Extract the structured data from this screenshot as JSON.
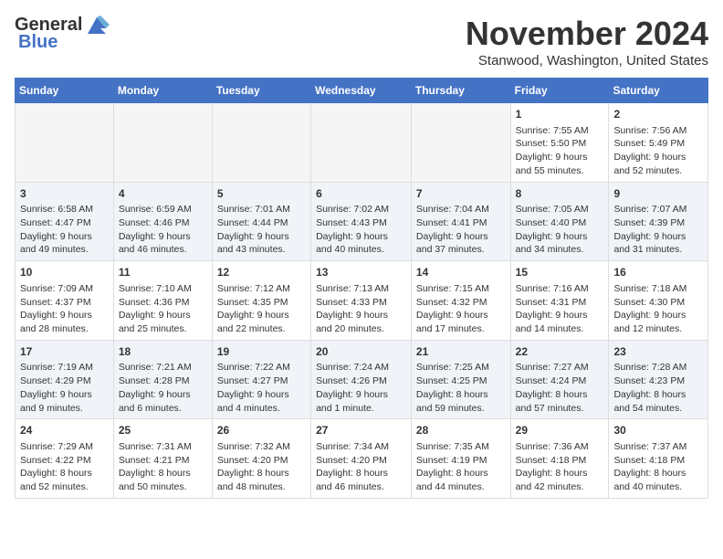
{
  "logo": {
    "general": "General",
    "blue": "Blue"
  },
  "title": "November 2024",
  "location": "Stanwood, Washington, United States",
  "days_of_week": [
    "Sunday",
    "Monday",
    "Tuesday",
    "Wednesday",
    "Thursday",
    "Friday",
    "Saturday"
  ],
  "weeks": [
    [
      {
        "day": "",
        "empty": true
      },
      {
        "day": "",
        "empty": true
      },
      {
        "day": "",
        "empty": true
      },
      {
        "day": "",
        "empty": true
      },
      {
        "day": "",
        "empty": true
      },
      {
        "day": "1",
        "sunrise": "Sunrise: 7:55 AM",
        "sunset": "Sunset: 5:50 PM",
        "daylight": "Daylight: 9 hours and 55 minutes."
      },
      {
        "day": "2",
        "sunrise": "Sunrise: 7:56 AM",
        "sunset": "Sunset: 5:49 PM",
        "daylight": "Daylight: 9 hours and 52 minutes."
      }
    ],
    [
      {
        "day": "3",
        "sunrise": "Sunrise: 6:58 AM",
        "sunset": "Sunset: 4:47 PM",
        "daylight": "Daylight: 9 hours and 49 minutes."
      },
      {
        "day": "4",
        "sunrise": "Sunrise: 6:59 AM",
        "sunset": "Sunset: 4:46 PM",
        "daylight": "Daylight: 9 hours and 46 minutes."
      },
      {
        "day": "5",
        "sunrise": "Sunrise: 7:01 AM",
        "sunset": "Sunset: 4:44 PM",
        "daylight": "Daylight: 9 hours and 43 minutes."
      },
      {
        "day": "6",
        "sunrise": "Sunrise: 7:02 AM",
        "sunset": "Sunset: 4:43 PM",
        "daylight": "Daylight: 9 hours and 40 minutes."
      },
      {
        "day": "7",
        "sunrise": "Sunrise: 7:04 AM",
        "sunset": "Sunset: 4:41 PM",
        "daylight": "Daylight: 9 hours and 37 minutes."
      },
      {
        "day": "8",
        "sunrise": "Sunrise: 7:05 AM",
        "sunset": "Sunset: 4:40 PM",
        "daylight": "Daylight: 9 hours and 34 minutes."
      },
      {
        "day": "9",
        "sunrise": "Sunrise: 7:07 AM",
        "sunset": "Sunset: 4:39 PM",
        "daylight": "Daylight: 9 hours and 31 minutes."
      }
    ],
    [
      {
        "day": "10",
        "sunrise": "Sunrise: 7:09 AM",
        "sunset": "Sunset: 4:37 PM",
        "daylight": "Daylight: 9 hours and 28 minutes."
      },
      {
        "day": "11",
        "sunrise": "Sunrise: 7:10 AM",
        "sunset": "Sunset: 4:36 PM",
        "daylight": "Daylight: 9 hours and 25 minutes."
      },
      {
        "day": "12",
        "sunrise": "Sunrise: 7:12 AM",
        "sunset": "Sunset: 4:35 PM",
        "daylight": "Daylight: 9 hours and 22 minutes."
      },
      {
        "day": "13",
        "sunrise": "Sunrise: 7:13 AM",
        "sunset": "Sunset: 4:33 PM",
        "daylight": "Daylight: 9 hours and 20 minutes."
      },
      {
        "day": "14",
        "sunrise": "Sunrise: 7:15 AM",
        "sunset": "Sunset: 4:32 PM",
        "daylight": "Daylight: 9 hours and 17 minutes."
      },
      {
        "day": "15",
        "sunrise": "Sunrise: 7:16 AM",
        "sunset": "Sunset: 4:31 PM",
        "daylight": "Daylight: 9 hours and 14 minutes."
      },
      {
        "day": "16",
        "sunrise": "Sunrise: 7:18 AM",
        "sunset": "Sunset: 4:30 PM",
        "daylight": "Daylight: 9 hours and 12 minutes."
      }
    ],
    [
      {
        "day": "17",
        "sunrise": "Sunrise: 7:19 AM",
        "sunset": "Sunset: 4:29 PM",
        "daylight": "Daylight: 9 hours and 9 minutes."
      },
      {
        "day": "18",
        "sunrise": "Sunrise: 7:21 AM",
        "sunset": "Sunset: 4:28 PM",
        "daylight": "Daylight: 9 hours and 6 minutes."
      },
      {
        "day": "19",
        "sunrise": "Sunrise: 7:22 AM",
        "sunset": "Sunset: 4:27 PM",
        "daylight": "Daylight: 9 hours and 4 minutes."
      },
      {
        "day": "20",
        "sunrise": "Sunrise: 7:24 AM",
        "sunset": "Sunset: 4:26 PM",
        "daylight": "Daylight: 9 hours and 1 minute."
      },
      {
        "day": "21",
        "sunrise": "Sunrise: 7:25 AM",
        "sunset": "Sunset: 4:25 PM",
        "daylight": "Daylight: 8 hours and 59 minutes."
      },
      {
        "day": "22",
        "sunrise": "Sunrise: 7:27 AM",
        "sunset": "Sunset: 4:24 PM",
        "daylight": "Daylight: 8 hours and 57 minutes."
      },
      {
        "day": "23",
        "sunrise": "Sunrise: 7:28 AM",
        "sunset": "Sunset: 4:23 PM",
        "daylight": "Daylight: 8 hours and 54 minutes."
      }
    ],
    [
      {
        "day": "24",
        "sunrise": "Sunrise: 7:29 AM",
        "sunset": "Sunset: 4:22 PM",
        "daylight": "Daylight: 8 hours and 52 minutes."
      },
      {
        "day": "25",
        "sunrise": "Sunrise: 7:31 AM",
        "sunset": "Sunset: 4:21 PM",
        "daylight": "Daylight: 8 hours and 50 minutes."
      },
      {
        "day": "26",
        "sunrise": "Sunrise: 7:32 AM",
        "sunset": "Sunset: 4:20 PM",
        "daylight": "Daylight: 8 hours and 48 minutes."
      },
      {
        "day": "27",
        "sunrise": "Sunrise: 7:34 AM",
        "sunset": "Sunset: 4:20 PM",
        "daylight": "Daylight: 8 hours and 46 minutes."
      },
      {
        "day": "28",
        "sunrise": "Sunrise: 7:35 AM",
        "sunset": "Sunset: 4:19 PM",
        "daylight": "Daylight: 8 hours and 44 minutes."
      },
      {
        "day": "29",
        "sunrise": "Sunrise: 7:36 AM",
        "sunset": "Sunset: 4:18 PM",
        "daylight": "Daylight: 8 hours and 42 minutes."
      },
      {
        "day": "30",
        "sunrise": "Sunrise: 7:37 AM",
        "sunset": "Sunset: 4:18 PM",
        "daylight": "Daylight: 8 hours and 40 minutes."
      }
    ]
  ]
}
